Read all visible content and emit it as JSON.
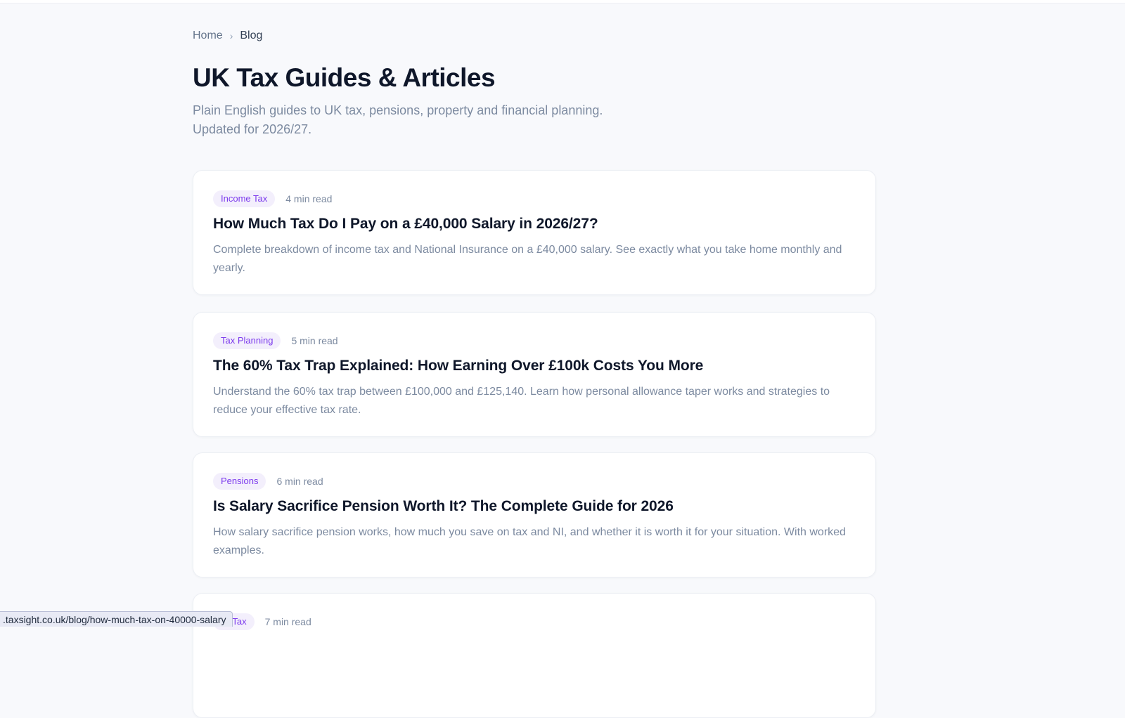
{
  "breadcrumb": {
    "home": "Home",
    "separator": "›",
    "current": "Blog"
  },
  "page": {
    "title": "UK Tax Guides & Articles",
    "subtitle": "Plain English guides to UK tax, pensions, property and financial planning. Updated for 2026/27."
  },
  "articles": [
    {
      "tag": "Income Tax",
      "read_time": "4 min read",
      "title": "How Much Tax Do I Pay on a £40,000 Salary in 2026/27?",
      "description": "Complete breakdown of income tax and National Insurance on a £40,000 salary. See exactly what you take home monthly and yearly."
    },
    {
      "tag": "Tax Planning",
      "read_time": "5 min read",
      "title": "The 60% Tax Trap Explained: How Earning Over £100k Costs You More",
      "description": "Understand the 60% tax trap between £100,000 and £125,140. Learn how personal allowance taper works and strategies to reduce your effective tax rate."
    },
    {
      "tag": "Pensions",
      "read_time": "6 min read",
      "title": "Is Salary Sacrifice Pension Worth It? The Complete Guide for 2026",
      "description": "How salary sacrifice pension works, how much you save on tax and NI, and whether it is worth it for your situation. With worked examples."
    },
    {
      "tag": "ss Tax",
      "read_time": "7 min read"
    }
  ],
  "status_bar": {
    "url": ".taxsight.co.uk/blog/how-much-tax-on-40000-salary"
  },
  "colors": {
    "background": "#f8f9fc",
    "tag_background": "#f3effc",
    "tag_text": "#7c3aed",
    "heading": "#0f172a",
    "muted": "#7c8aa0"
  }
}
